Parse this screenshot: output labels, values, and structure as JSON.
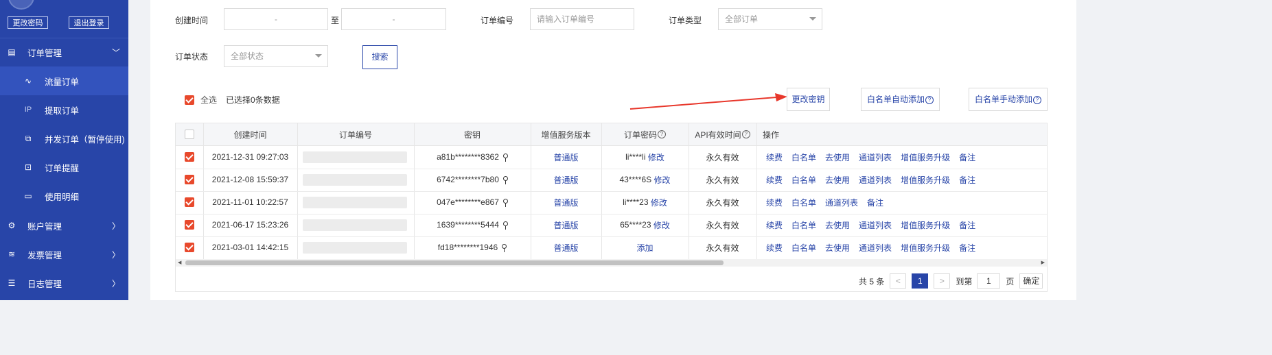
{
  "sidebar": {
    "change_password": "更改密码",
    "logout": "退出登录",
    "order_mgmt": "订单管理",
    "items": [
      "流量订单",
      "提取订单",
      "并发订单（暂停使用)",
      "订单提醒",
      "使用明细"
    ],
    "ip_icon_text": "IP",
    "account_mgmt": "账户管理",
    "invoice_mgmt": "发票管理",
    "log_mgmt": "日志管理"
  },
  "filters": {
    "created_label": "创建时间",
    "date_dash": "-",
    "to": "至",
    "order_no_label": "订单编号",
    "order_no_placeholder": "请输入订单编号",
    "order_type_label": "订单类型",
    "order_type_value": "全部订单",
    "order_status_label": "订单状态",
    "order_status_value": "全部状态",
    "search": "搜索"
  },
  "toolbar": {
    "select_all": "全选",
    "selected_text": "已选择0条数据",
    "change_key": "更改密钥",
    "whitelist_auto": "白名单自动添加",
    "whitelist_manual": "白名单手动添加",
    "question": "?"
  },
  "table": {
    "headers": [
      "创建时间",
      "订单编号",
      "密钥",
      "增值服务版本",
      "订单密码",
      "API有效时间",
      "操作"
    ],
    "rows": [
      {
        "time": "2021-12-31 09:27:03",
        "key": "a81b********8362",
        "version": "普通版",
        "pwd": "li****li",
        "pwd_action": "修改",
        "api": "永久有效",
        "ops": [
          "续费",
          "白名单",
          "去使用",
          "通道列表",
          "增值服务升级",
          "备注"
        ]
      },
      {
        "time": "2021-12-08 15:59:37",
        "key": "6742********7b80",
        "version": "普通版",
        "pwd": "43****6S",
        "pwd_action": "修改",
        "api": "永久有效",
        "ops": [
          "续费",
          "白名单",
          "去使用",
          "通道列表",
          "增值服务升级",
          "备注"
        ]
      },
      {
        "time": "2021-11-01 10:22:57",
        "key": "047e********e867",
        "version": "普通版",
        "pwd": "li****23",
        "pwd_action": "修改",
        "api": "永久有效",
        "ops": [
          "续费",
          "白名单",
          "通道列表",
          "备注"
        ]
      },
      {
        "time": "2021-06-17 15:23:26",
        "key": "1639********5444",
        "version": "普通版",
        "pwd": "65****23",
        "pwd_action": "修改",
        "api": "永久有效",
        "ops": [
          "续费",
          "白名单",
          "去使用",
          "通道列表",
          "增值服务升级",
          "备注"
        ]
      },
      {
        "time": "2021-03-01 14:42:15",
        "key": "fd18********1946",
        "version": "普通版",
        "pwd": "",
        "pwd_action": "添加",
        "api": "永久有效",
        "ops": [
          "续费",
          "白名单",
          "去使用",
          "通道列表",
          "增值服务升级",
          "备注"
        ]
      }
    ]
  },
  "pagination": {
    "total": "共 5 条",
    "prev": "<",
    "current": "1",
    "next": ">",
    "goto": "到第",
    "goto_value": "1",
    "page_unit": "页",
    "confirm": "确定"
  },
  "colors": {
    "sidebar_bg": "#2845a8",
    "accent": "#2845a8",
    "checkbox": "#e8492c",
    "arrow": "#e8372b"
  }
}
